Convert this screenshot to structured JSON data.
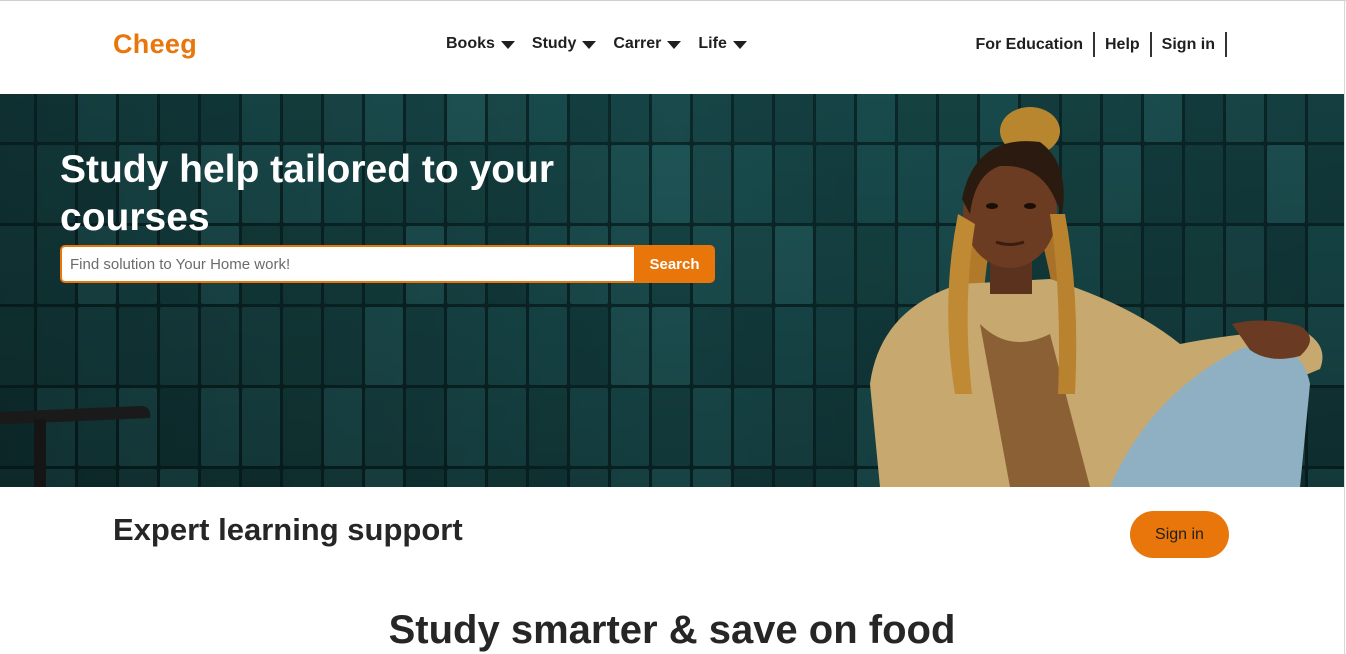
{
  "header": {
    "logo": "Cheeg",
    "nav": [
      {
        "label": "Books"
      },
      {
        "label": "Study"
      },
      {
        "label": "Carrer"
      },
      {
        "label": "Life"
      }
    ],
    "right_links": [
      {
        "label": "For Education"
      },
      {
        "label": "Help"
      },
      {
        "label": "Sign in"
      }
    ]
  },
  "hero": {
    "title": "Study help tailored to your courses",
    "search": {
      "placeholder": "Find solution to Your Home work!",
      "button_label": "Search"
    }
  },
  "section": {
    "heading": "Expert learning support",
    "signin_label": "Sign in",
    "subheading": "Study smarter & save on food"
  },
  "colors": {
    "accent": "#e8760a",
    "tile": "#1c5557",
    "grout": "#0d2f31"
  }
}
